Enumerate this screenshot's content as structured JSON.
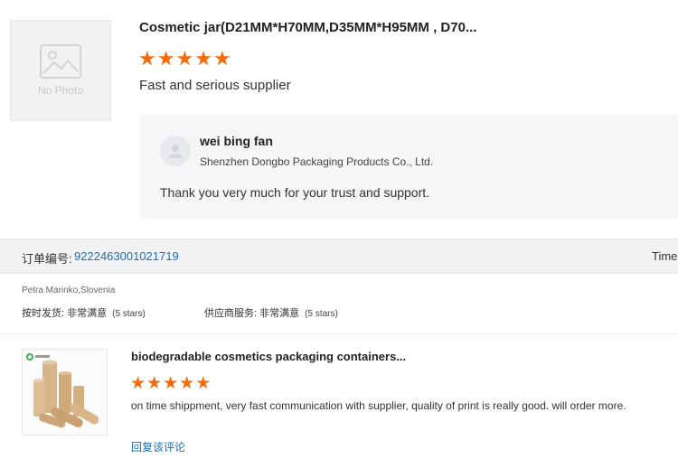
{
  "review1": {
    "image_placeholder_label": "No Photo",
    "product_title": "Cosmetic jar(D21MM*H70MM,D35MM*H95MM , D70...",
    "rating_stars": 5,
    "review_text": "Fast and serious supplier",
    "reply": {
      "name": "wei bing fan",
      "company": "Shenzhen Dongbo Packaging Products Co., Ltd.",
      "text": "Thank you very much for your trust and support."
    }
  },
  "order": {
    "label": "订单编号:",
    "number": "9222463001021719",
    "time_label": "Time"
  },
  "review2_meta": {
    "buyer": "Petra Marinko,Slovenia",
    "ratings": [
      {
        "label": "按时发货: 非常满意",
        "note": "(5 stars)"
      },
      {
        "label": "供应商服务: 非常满意",
        "note": "(5 stars)"
      }
    ]
  },
  "review2": {
    "product_title": "biodegradable cosmetics packaging containers...",
    "rating_stars": 5,
    "review_text": "on time shippment, very fast communication with supplier, quality of print is really good. will order more.",
    "reply_link": "回复该评论"
  },
  "colors": {
    "star": "#f56b0a",
    "link": "#1a6fb8",
    "reply_bg": "#f4f6f8",
    "order_bar_bg": "#f1f2f4"
  },
  "icons": {
    "placeholder": "image-placeholder-icon",
    "avatar": "supplier-avatar-icon",
    "star": "star-icon"
  }
}
